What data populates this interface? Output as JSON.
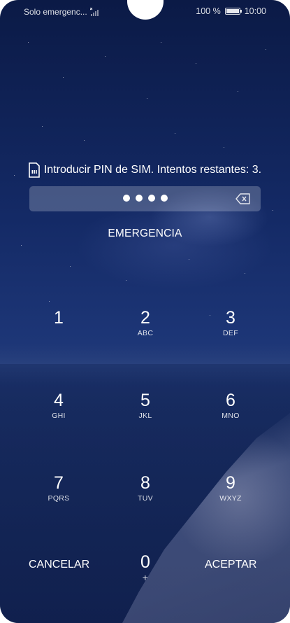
{
  "status_bar": {
    "carrier_text": "Solo emergenc...",
    "battery_percent": "100 %",
    "time": "10:00",
    "icons": [
      "no-signal-icon",
      "battery-icon"
    ]
  },
  "sim_lock": {
    "prompt": "Introducir PIN de SIM. Intentos restantes: 3.",
    "pin_dot_count": 4,
    "emergency_label": "EMERGENCIA"
  },
  "keypad": {
    "keys": [
      {
        "num": "1",
        "letters": ""
      },
      {
        "num": "2",
        "letters": "ABC"
      },
      {
        "num": "3",
        "letters": "DEF"
      },
      {
        "num": "4",
        "letters": "GHI"
      },
      {
        "num": "5",
        "letters": "JKL"
      },
      {
        "num": "6",
        "letters": "MNO"
      },
      {
        "num": "7",
        "letters": "PQRS"
      },
      {
        "num": "8",
        "letters": "TUV"
      },
      {
        "num": "9",
        "letters": "WXYZ"
      },
      {
        "num": "0",
        "letters": "+"
      }
    ],
    "cancel_label": "CANCELAR",
    "accept_label": "ACEPTAR"
  }
}
